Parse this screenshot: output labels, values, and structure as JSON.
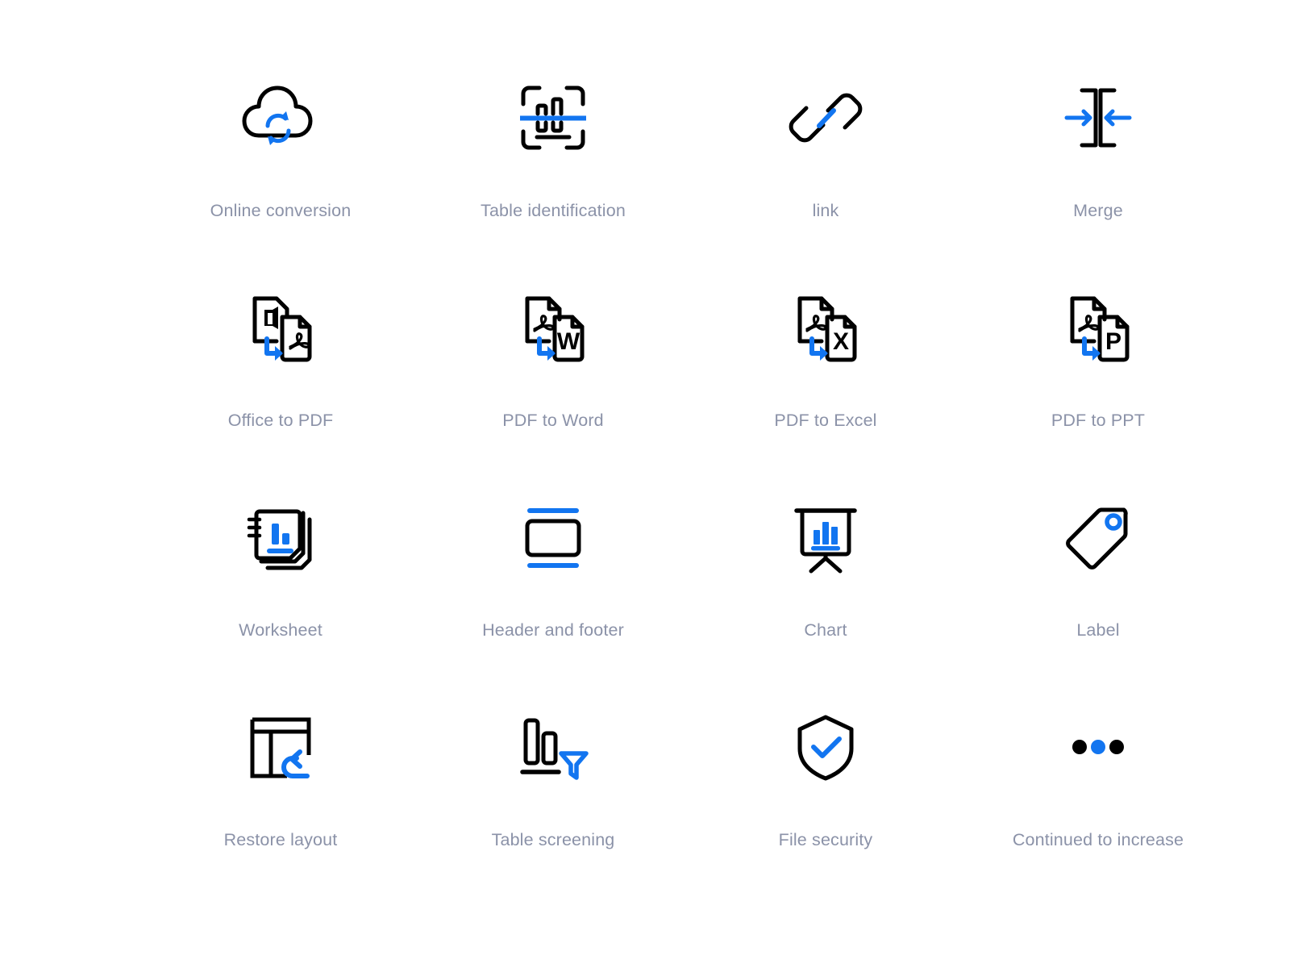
{
  "page": {
    "background_color": "#ffffff",
    "label_color": "#8b92a8",
    "icon_stroke_color": "#000000",
    "icon_accent_color": "#1275f0",
    "columns": 4,
    "rows": 4
  },
  "icons": [
    {
      "id": "online-conversion",
      "label": "Online conversion",
      "glyph": "cloud-sync-icon",
      "row": 1,
      "col": 1
    },
    {
      "id": "table-identification",
      "label": "Table identification",
      "glyph": "scan-table-icon",
      "row": 1,
      "col": 2
    },
    {
      "id": "link",
      "label": "link",
      "glyph": "chain-link-icon",
      "row": 1,
      "col": 3
    },
    {
      "id": "merge",
      "label": "Merge",
      "glyph": "merge-arrows-icon",
      "row": 1,
      "col": 4
    },
    {
      "id": "office-to-pdf",
      "label": "Office to PDF",
      "glyph": "office-to-pdf-icon",
      "row": 2,
      "col": 1
    },
    {
      "id": "pdf-to-word",
      "label": "PDF to Word",
      "glyph": "pdf-to-word-icon",
      "row": 2,
      "col": 2,
      "badge": "W"
    },
    {
      "id": "pdf-to-excel",
      "label": "PDF to Excel",
      "glyph": "pdf-to-excel-icon",
      "row": 2,
      "col": 3,
      "badge": "X"
    },
    {
      "id": "pdf-to-ppt",
      "label": "PDF to PPT",
      "glyph": "pdf-to-ppt-icon",
      "row": 2,
      "col": 4,
      "badge": "P"
    },
    {
      "id": "worksheet",
      "label": "Worksheet",
      "glyph": "notebook-chart-icon",
      "row": 3,
      "col": 1
    },
    {
      "id": "header-and-footer",
      "label": "Header and footer",
      "glyph": "header-footer-icon",
      "row": 3,
      "col": 2
    },
    {
      "id": "chart",
      "label": "Chart",
      "glyph": "presentation-chart-icon",
      "row": 3,
      "col": 3
    },
    {
      "id": "label",
      "label": "Label",
      "glyph": "price-tag-icon",
      "row": 3,
      "col": 4
    },
    {
      "id": "restore-layout",
      "label": "Restore layout",
      "glyph": "table-undo-icon",
      "row": 4,
      "col": 1
    },
    {
      "id": "table-screening",
      "label": "Table screening",
      "glyph": "bars-filter-icon",
      "row": 4,
      "col": 2
    },
    {
      "id": "file-security",
      "label": "File security",
      "glyph": "shield-check-icon",
      "row": 4,
      "col": 3
    },
    {
      "id": "continued-to-increase",
      "label": "Continued to increase",
      "glyph": "ellipsis-icon",
      "row": 4,
      "col": 4
    }
  ]
}
